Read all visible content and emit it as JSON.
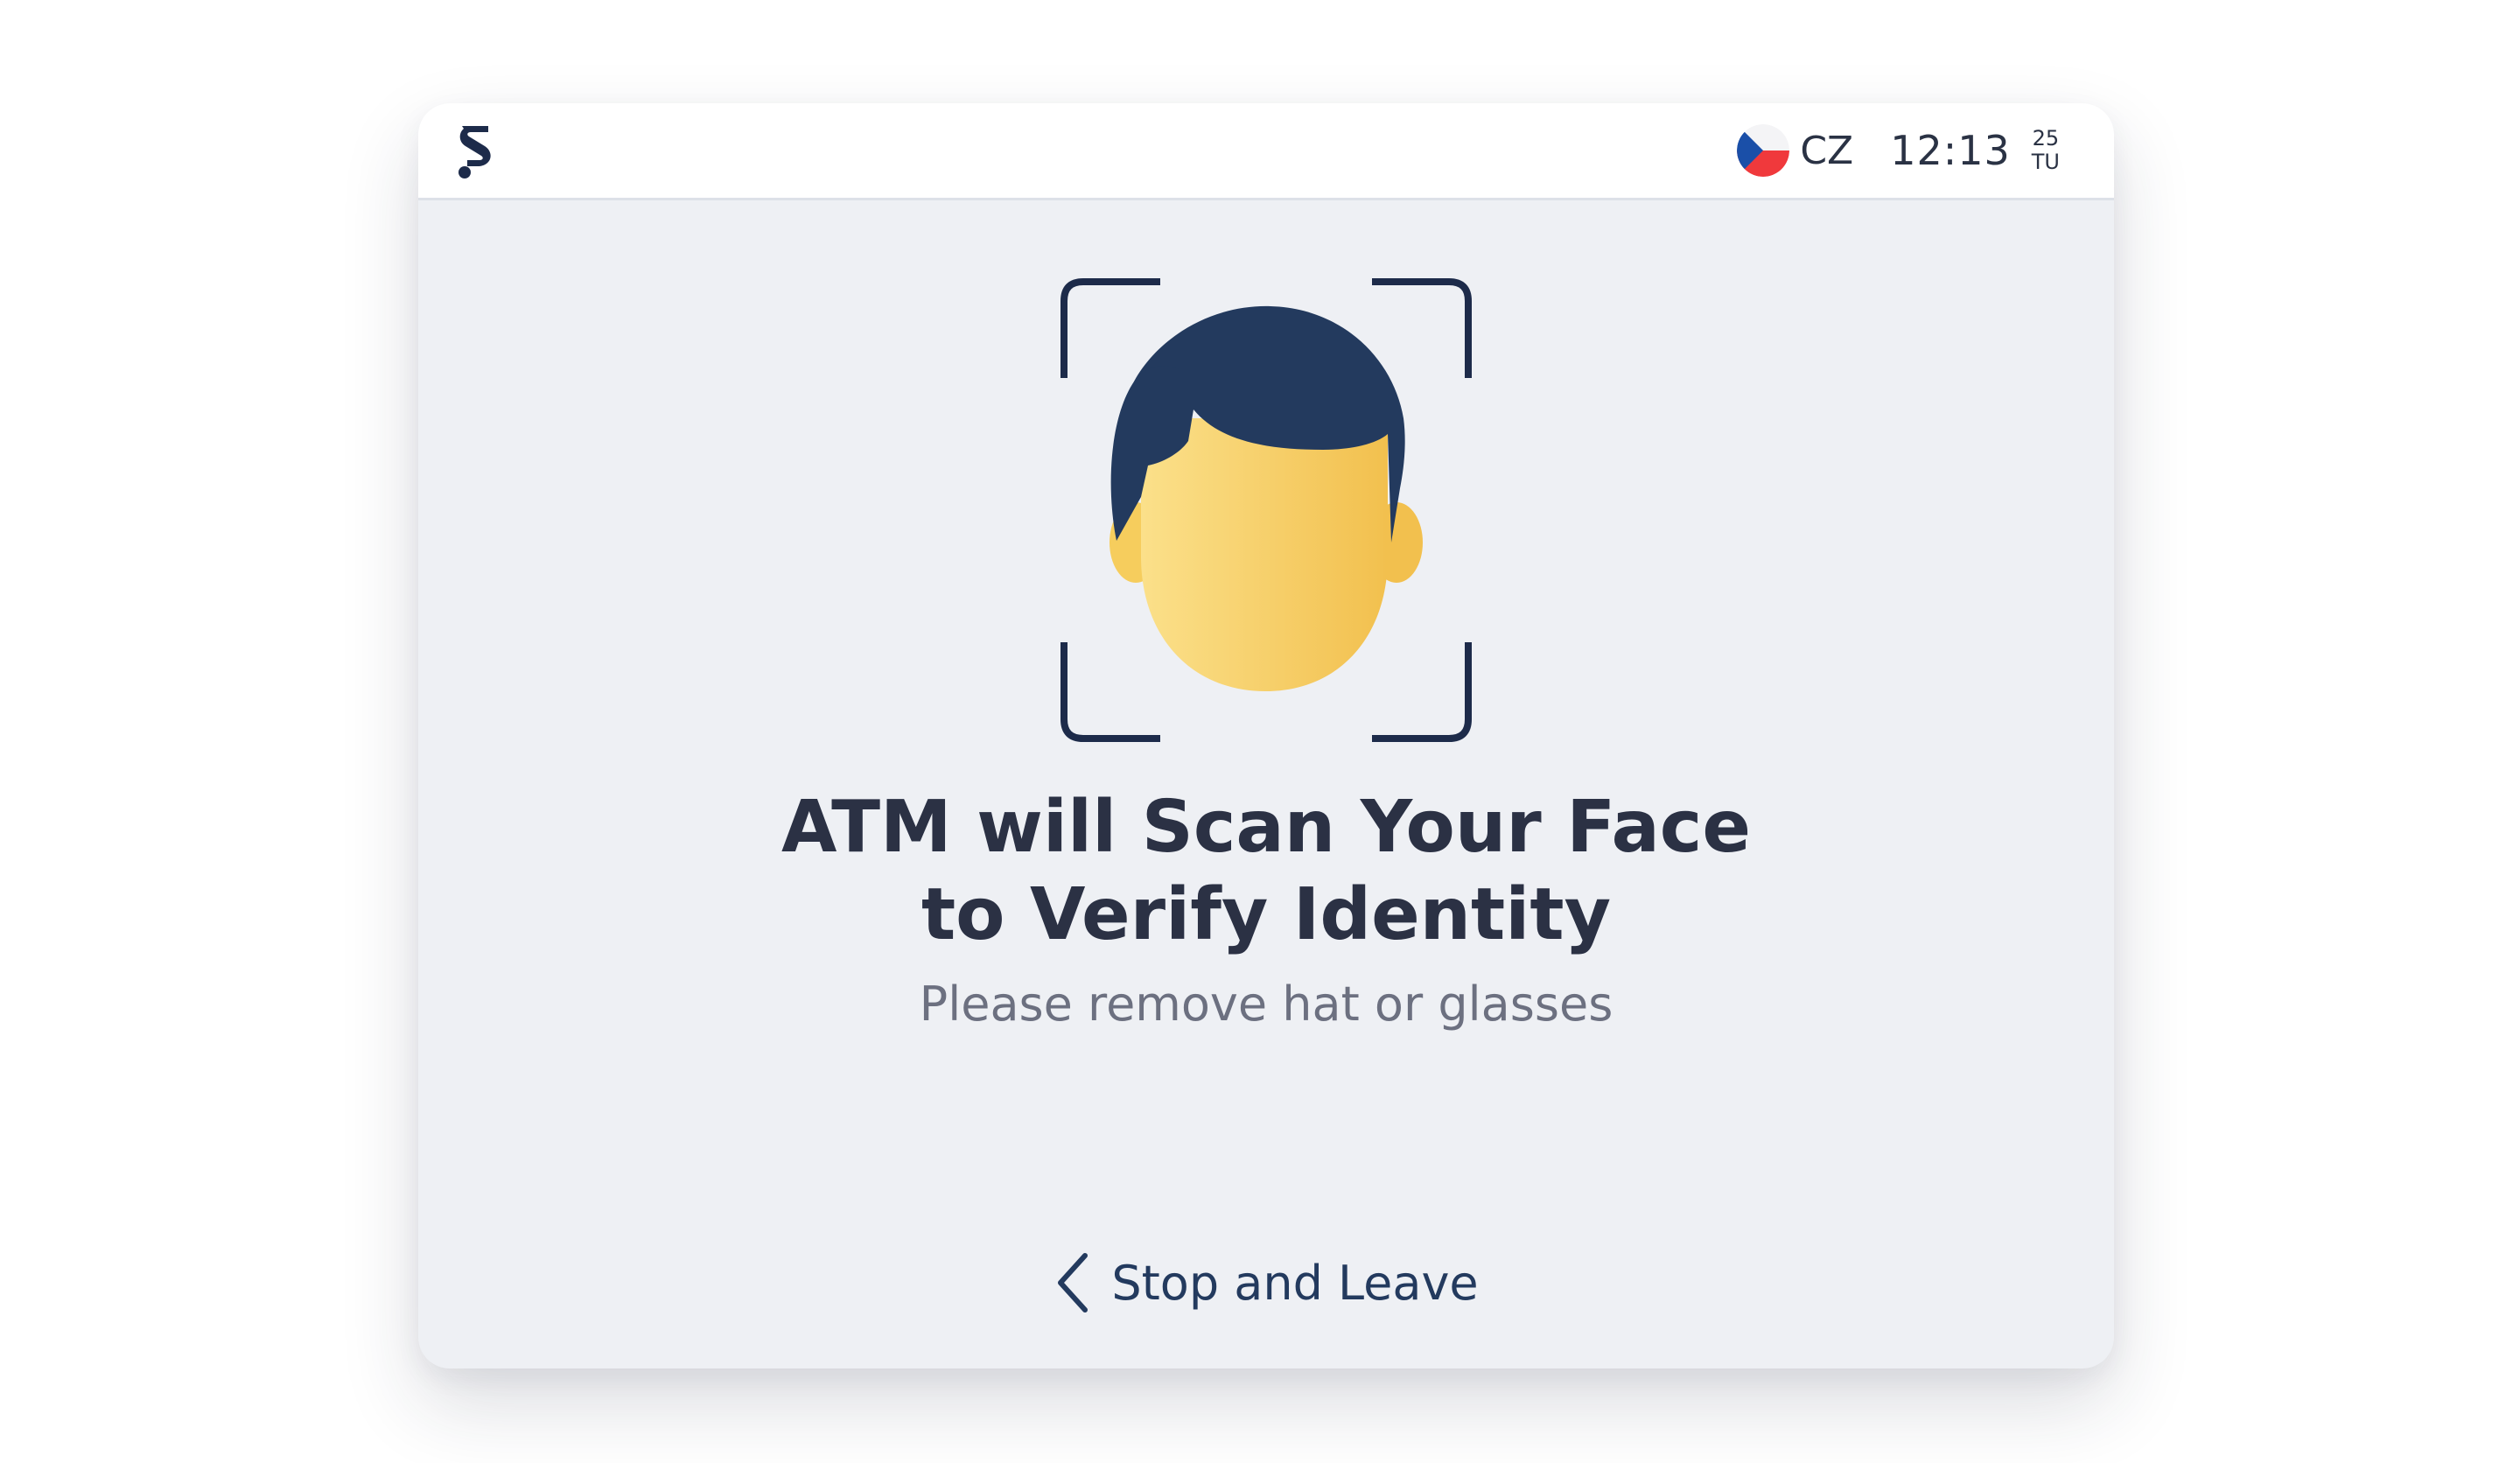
{
  "app": {
    "logo_icon": "brand-s-logo-icon"
  },
  "status_bar": {
    "flag_icon": "czech-flag-icon",
    "language": "CZ",
    "time": "12:13",
    "date_day": "25",
    "date_weekday": "TU"
  },
  "main": {
    "illustration_icon": "face-scan-icon",
    "title_line1": "ATM will Scan Your Face",
    "title_line2": "to Verify Identity",
    "subtitle": "Please remove hat or glasses"
  },
  "footer": {
    "back_icon": "chevron-left-icon",
    "stop_label": "Stop and Leave"
  },
  "colors": {
    "frame": "#1d2b4a",
    "hair": "#233a5e",
    "skin_light": "#fbe08a",
    "skin_dark": "#f2c04e",
    "text_dark": "#2b3144",
    "text_muted": "#6c7080",
    "accent": "#233a5e",
    "screen_bg": "#eef0f4"
  }
}
